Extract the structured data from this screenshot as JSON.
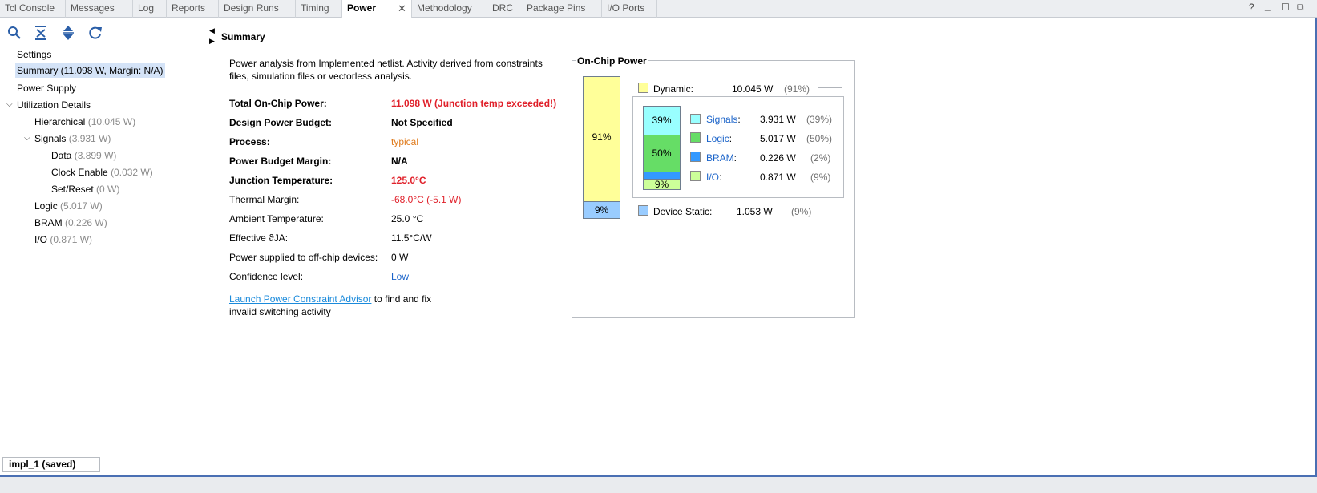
{
  "tabs": [
    {
      "label": "Tcl Console"
    },
    {
      "label": "Messages"
    },
    {
      "label": "Log"
    },
    {
      "label": "Reports"
    },
    {
      "label": "Design Runs"
    },
    {
      "label": "Timing"
    },
    {
      "label": "Power"
    },
    {
      "label": "Methodology"
    },
    {
      "label": "DRC"
    },
    {
      "label": "Package Pins"
    },
    {
      "label": "I/O Ports"
    }
  ],
  "active_tab": "Power",
  "window_controls": {
    "help": "?",
    "minimize": "_",
    "maximize": "☐",
    "float": "⧉"
  },
  "toolbar_icons": [
    "search-icon",
    "collapse-all-icon",
    "expand-all-icon",
    "refresh-icon"
  ],
  "tree": {
    "settings": "Settings",
    "summary": "Summary (11.098 W, Margin: N/A)",
    "power_supply": "Power Supply",
    "utilization_details": "Utilization Details",
    "hierarchical": {
      "label": "Hierarchical",
      "value": "(10.045 W)"
    },
    "signals": {
      "label": "Signals",
      "value": "(3.931 W)"
    },
    "data": {
      "label": "Data",
      "value": "(3.899 W)"
    },
    "clock_enable": {
      "label": "Clock Enable",
      "value": "(0.032 W)"
    },
    "set_reset": {
      "label": "Set/Reset",
      "value": "(0 W)"
    },
    "logic": {
      "label": "Logic",
      "value": "(5.017 W)"
    },
    "bram": {
      "label": "BRAM",
      "value": "(0.226 W)"
    },
    "io": {
      "label": "I/O",
      "value": "(0.871 W)"
    }
  },
  "summary": {
    "title": "Summary",
    "intro": "Power analysis from Implemented netlist. Activity derived from constraints files, simulation files or vectorless analysis.",
    "rows": {
      "total_on_chip_power": {
        "label": "Total On-Chip Power:",
        "value": "11.098 W (Junction temp exceeded!)"
      },
      "design_power_budget": {
        "label": "Design Power Budget:",
        "value": "Not Specified"
      },
      "process": {
        "label": "Process:",
        "value": "typical"
      },
      "power_budget_margin": {
        "label": "Power Budget Margin:",
        "value": "N/A"
      },
      "junction_temperature": {
        "label": "Junction Temperature:",
        "value": "125.0°C"
      },
      "thermal_margin": {
        "label": "Thermal Margin:",
        "value": "-68.0°C (-5.1 W)"
      },
      "ambient_temperature": {
        "label": "Ambient Temperature:",
        "value": "25.0 °C"
      },
      "effective_theta_ja": {
        "label": "Effective ϑJA:",
        "value": "11.5°C/W"
      },
      "power_off_chip": {
        "label": "Power supplied to off-chip devices:",
        "value": "0 W"
      },
      "confidence_level": {
        "label": "Confidence level:",
        "value": "Low"
      }
    },
    "advisor_link": "Launch Power Constraint Advisor",
    "advisor_rest": " to find and fix invalid switching activity"
  },
  "on_chip_power": {
    "title": "On-Chip Power",
    "main_bar": {
      "dynamic_pct": "91%",
      "static_pct": "9%"
    },
    "dynamic": {
      "label": "Dynamic:",
      "value": "10.045 W",
      "pct": "(91%)"
    },
    "sub_bar": {
      "signals_pct": "39%",
      "logic_pct": "50%",
      "io_pct": "9%"
    },
    "signals": {
      "label": "Signals",
      "colon": ":",
      "value": "3.931 W",
      "pct": "(39%)"
    },
    "logic": {
      "label": "Logic",
      "colon": ":",
      "value": "5.017 W",
      "pct": "(50%)"
    },
    "bram": {
      "label": "BRAM",
      "colon": ":",
      "value": "0.226 W",
      "pct": "(2%)"
    },
    "io": {
      "label": "I/O",
      "colon": ":",
      "value": "0.871 W",
      "pct": "(9%)"
    },
    "device_static": {
      "label": "Device Static:",
      "value": "1.053 W",
      "pct": "(9%)"
    },
    "colors": {
      "dynamic": "#ffff99",
      "static": "#99ccff",
      "signals": "#99ffff",
      "logic": "#66dd66",
      "bram": "#3399ff",
      "io": "#ccff99"
    }
  },
  "bottom": {
    "run_tab": "impl_1 (saved)"
  }
}
